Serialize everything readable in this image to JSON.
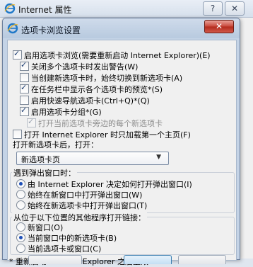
{
  "outer_window": {
    "title": "Internet 属性",
    "help_label": "?",
    "close_label": "✕"
  },
  "dialog": {
    "title": "选项卡浏览设置",
    "close_label": "✕"
  },
  "enable_tabs": {
    "label": "启用选项卡浏览(需要重新启动 Internet Explorer)(E)",
    "checked": true
  },
  "tab_options": [
    {
      "label": "关闭多个选项卡时发出警告(W)",
      "checked": true,
      "disabled": false
    },
    {
      "label": "当创建新选项卡时，始终切换到新选项卡(A)",
      "checked": false,
      "disabled": false
    },
    {
      "label": "在任务栏中显示各个选项卡的预览*(S)",
      "checked": true,
      "disabled": false
    },
    {
      "label": "启用快速导航选项卡(Ctrl+Q)*(Q)",
      "checked": false,
      "disabled": false
    },
    {
      "label": "启用选项卡分组*(G)",
      "checked": true,
      "disabled": false
    },
    {
      "label": "打开当前选项卡旁边的每个新选项卡",
      "checked": true,
      "disabled": true
    },
    {
      "label": "打开 Internet Explorer 时只加载第一个主页(F)",
      "checked": false,
      "disabled": false
    }
  ],
  "new_tab": {
    "label": "打开新选项卡后，打开：",
    "selected": "新选项卡页",
    "arrow": "▼"
  },
  "popup_group": {
    "title": "遇到弹出窗口时：",
    "options": [
      {
        "label": "由 Internet Explorer 决定如何打开弹出窗口(I)",
        "checked": true
      },
      {
        "label": "始终在新窗口中打开弹出窗口(W)",
        "checked": false
      },
      {
        "label": "始终在新选项卡中打开弹出窗口(T)",
        "checked": false
      }
    ]
  },
  "links_group": {
    "title": "从位于以下位置的其他程序打开链接：",
    "options": [
      {
        "label": "新窗口(O)",
        "checked": false
      },
      {
        "label": "当前窗口中的新选项卡(B)",
        "checked": true
      },
      {
        "label": "当前选项卡或窗口(C)",
        "checked": false
      }
    ]
  },
  "footnote": "* 重新启动 Internet Explorer 之后生效"
}
